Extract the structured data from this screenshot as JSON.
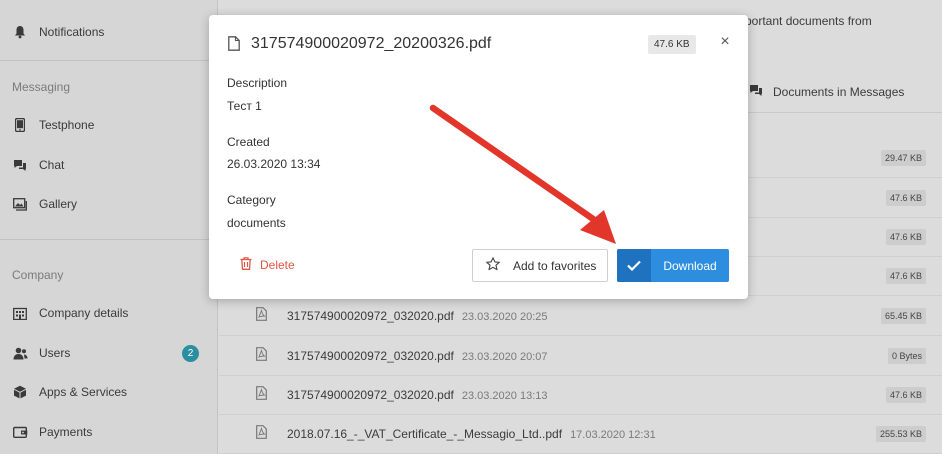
{
  "sidebar": {
    "notifications_label": "Notifications",
    "messaging_header": "Messaging",
    "testphone_label": "Testphone",
    "chat_label": "Chat",
    "gallery_label": "Gallery",
    "company_header": "Company",
    "company_details_label": "Company details",
    "users_label": "Users",
    "users_badge": "2",
    "apps_label": "Apps & Services",
    "payments_label": "Payments"
  },
  "main": {
    "intro_text": "portant documents from",
    "tab_docs_in_messages": "Documents in Messages",
    "documents": [
      {
        "name": "",
        "date": "",
        "size": "29.47 KB"
      },
      {
        "name": "",
        "date": "",
        "size": "47.6 KB"
      },
      {
        "name": "",
        "date": "",
        "size": "47.6 KB"
      },
      {
        "name": "",
        "date": "",
        "size": "47.6 KB"
      },
      {
        "name": "317574900020972_032020.pdf",
        "date": "23.03.2020 20:25",
        "size": "65.45 KB"
      },
      {
        "name": "317574900020972_032020.pdf",
        "date": "23.03.2020 20:07",
        "size": "0 Bytes"
      },
      {
        "name": "317574900020972_032020.pdf",
        "date": "23.03.2020 13:13",
        "size": "47.6 KB"
      },
      {
        "name": "2018.07.16_-_VAT_Certificate_-_Messagio_Ltd..pdf",
        "date": "17.03.2020 12:31",
        "size": "255.53 KB"
      }
    ]
  },
  "modal": {
    "file_name": "317574900020972_20200326.pdf",
    "file_size": "47.6 KB",
    "close_symbol": "×",
    "description_label": "Description",
    "description_value": "Тест 1",
    "created_label": "Created",
    "created_value": "26.03.2020 13:34",
    "category_label": "Category",
    "category_value": "documents",
    "delete_label": "Delete",
    "favorites_label": "Add to favorites",
    "download_label": "Download"
  },
  "colors": {
    "accent_blue": "#2d8ee0",
    "delete_red": "#e25544",
    "badge_teal": "#2a8fa0",
    "arrow_red": "#e2362a"
  },
  "icons": [
    "bell-icon",
    "phone-icon",
    "chat-icon",
    "gallery-icon",
    "building-icon",
    "users-icon",
    "box-icon",
    "wallet-icon",
    "file-icon",
    "pdf-icon",
    "trash-icon",
    "star-icon",
    "check-icon"
  ]
}
